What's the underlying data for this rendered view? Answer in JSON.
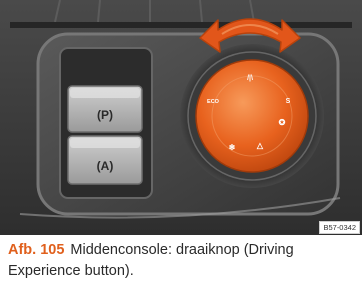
{
  "figure": {
    "reference_code": "B57-0342",
    "parking_brake_symbol": "(P)",
    "autohold_symbol": "(A)",
    "knob_labels": {
      "top": "/|\\",
      "left": "ECO",
      "right": "S",
      "right_lower": "✪",
      "bottom_left": "❄",
      "bottom_right": "△"
    },
    "colors": {
      "knob_orange": "#e8621e",
      "arrow_orange": "#e2561a",
      "console_dark": "#3a3a3a",
      "caption_accent": "#e0601d"
    }
  },
  "caption": {
    "label": "Afb. 105",
    "text": "Middenconsole: draaiknop (Driving Experience button)."
  }
}
